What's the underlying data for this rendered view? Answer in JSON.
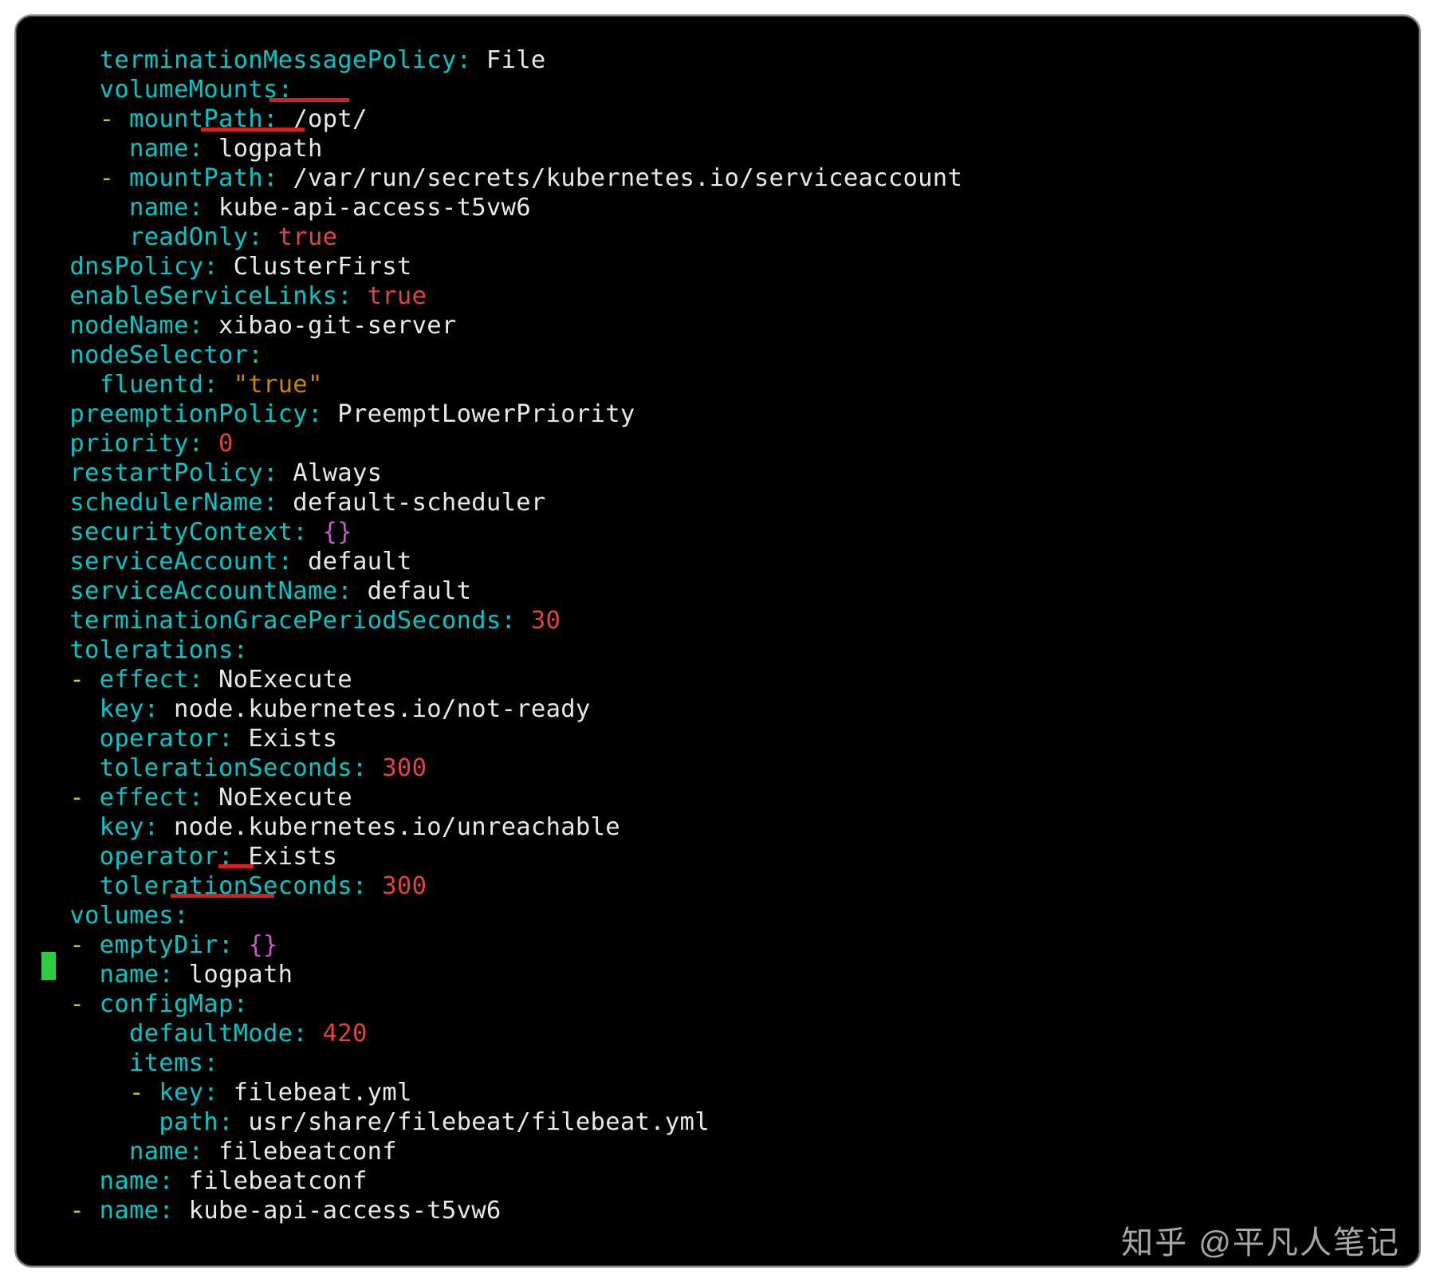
{
  "watermark": "知乎 @平凡人笔记",
  "yaml": {
    "terminationMessagePolicy": "File",
    "volumeMounts": [
      {
        "mountPath": "/opt/",
        "name": "logpath"
      },
      {
        "mountPath": "/var/run/secrets/kubernetes.io/serviceaccount",
        "name": "kube-api-access-t5vw6",
        "readOnly": "true"
      }
    ],
    "dnsPolicy": "ClusterFirst",
    "enableServiceLinks": "true",
    "nodeName": "xibao-git-server",
    "nodeSelector": {
      "fluentd": "\"true\""
    },
    "preemptionPolicy": "PreemptLowerPriority",
    "priority": "0",
    "restartPolicy": "Always",
    "schedulerName": "default-scheduler",
    "securityContext": "{}",
    "serviceAccount": "default",
    "serviceAccountName": "default",
    "terminationGracePeriodSeconds": "30",
    "tolerations": [
      {
        "effect": "NoExecute",
        "key": "node.kubernetes.io/not-ready",
        "operator": "Exists",
        "tolerationSeconds": "300"
      },
      {
        "effect": "NoExecute",
        "key": "node.kubernetes.io/unreachable",
        "operator": "Exists",
        "tolerationSeconds": "300"
      }
    ],
    "volumes": [
      {
        "emptyDir": "{}",
        "name": "logpath"
      },
      {
        "configMap": {
          "defaultMode": "420",
          "items": [
            {
              "key": "filebeat.yml",
              "path": "usr/share/filebeat/filebeat.yml"
            }
          ],
          "name": "filebeatconf"
        },
        "name": "filebeatconf"
      },
      {
        "name": "kube-api-access-t5vw6"
      }
    ]
  }
}
